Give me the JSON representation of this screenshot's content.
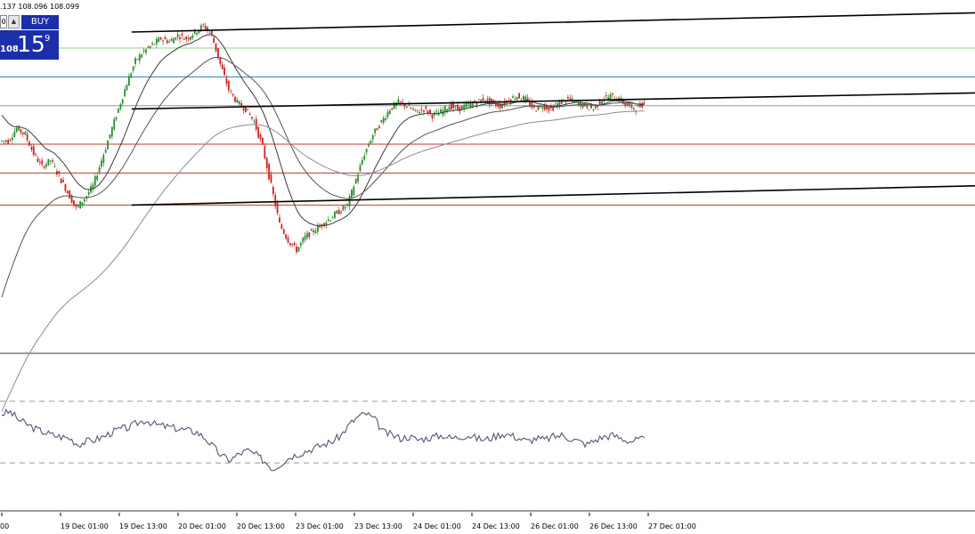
{
  "header": {
    "ohlc_text": ".137 108.096 108.099"
  },
  "trade_widget": {
    "lot_value": "0",
    "arrow": "▲",
    "buy_label": "BUY",
    "price_small": "108",
    "price_big": "15",
    "price_sup": "9"
  },
  "colors": {
    "candle_up": "#2e8b2e",
    "candle_down": "#cc2222",
    "ma_fast": "#3a3a3a",
    "ma_mid": "#555555",
    "ma_slow": "#8a8aa0",
    "trendline": "#000000",
    "level_red": "#c0392b",
    "level_blue": "#2c7bb6",
    "level_green": "#8fd18f",
    "level_gray": "#999999",
    "rsi": "#555577"
  },
  "chart_data": [
    {
      "type": "candlestick",
      "title": "",
      "x_tick_labels": [
        "00",
        "19 Dec 01:00",
        "19 Dec 13:00",
        "20 Dec 01:00",
        "20 Dec 13:00",
        "23 Dec 01:00",
        "23 Dec 13:00",
        "24 Dec 01:00",
        "24 Dec 13:00",
        "26 Dec 01:00",
        "26 Dec 13:00",
        "27 Dec 01:00"
      ],
      "price_path": [
        107.86,
        107.9,
        107.88,
        107.82,
        107.78,
        107.8,
        107.75,
        107.7,
        107.65,
        107.68,
        107.72,
        107.8,
        107.88,
        107.96,
        108.04,
        108.11,
        108.14,
        108.16,
        108.18,
        108.17,
        108.19,
        108.18,
        108.2,
        108.22,
        108.19,
        108.1,
        108.02,
        107.98,
        107.96,
        107.92,
        107.84,
        107.72,
        107.6,
        107.55,
        107.52,
        107.56,
        107.58,
        107.6,
        107.62,
        107.64,
        107.66,
        107.74,
        107.82,
        107.88,
        107.92,
        107.96,
        107.98,
        107.97,
        107.95,
        107.96,
        107.94,
        107.95,
        107.97,
        107.96,
        107.97,
        107.98,
        107.99,
        107.98,
        107.97,
        107.99,
        108.0,
        107.99,
        107.96,
        107.97,
        107.96,
        107.98,
        107.99,
        107.98,
        107.97,
        107.96,
        107.99,
        108.0,
        107.99,
        107.97,
        107.96,
        107.98
      ],
      "horizontal_levels": [
        {
          "price": 108.15,
          "color": "level_green"
        },
        {
          "price": 108.06,
          "color": "level_blue"
        },
        {
          "price": 107.97,
          "color": "level_gray"
        },
        {
          "price": 107.85,
          "color": "level_red"
        },
        {
          "price": 107.76,
          "color": "level_red"
        },
        {
          "price": 107.66,
          "color": "level_red"
        }
      ],
      "trendlines": [
        {
          "x1": 5,
          "y1": 108.2,
          "x2": 100,
          "y2": 108.26
        },
        {
          "x1": 5,
          "y1": 107.96,
          "x2": 100,
          "y2": 108.01
        },
        {
          "x1": 5,
          "y1": 107.66,
          "x2": 100,
          "y2": 107.72
        }
      ],
      "ylim": [
        107.2,
        108.3
      ],
      "xlim": [
        0,
        100
      ]
    },
    {
      "type": "line",
      "title": "",
      "series_name": "",
      "values": [
        62,
        63,
        58,
        55,
        52,
        50,
        48,
        47,
        46,
        42,
        44,
        45,
        47,
        50,
        52,
        53,
        56,
        58,
        55,
        54,
        53,
        52,
        51,
        50,
        46,
        40,
        34,
        32,
        36,
        38,
        35,
        31,
        26,
        30,
        34,
        36,
        38,
        40,
        42,
        44,
        48,
        55,
        60,
        62,
        58,
        50,
        48,
        46,
        47,
        45,
        46,
        47,
        48,
        46,
        47,
        48,
        46,
        45,
        47,
        49,
        48,
        46,
        44,
        46,
        45,
        47,
        48,
        46,
        44,
        42,
        45,
        47,
        48,
        46,
        44,
        45
      ],
      "dashed_levels": [
        70,
        30
      ],
      "ylim": [
        0,
        100
      ]
    }
  ]
}
